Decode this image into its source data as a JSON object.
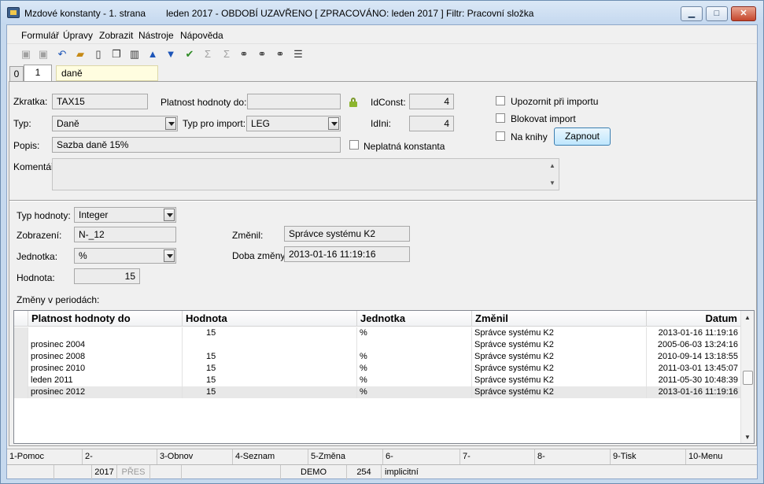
{
  "window": {
    "title": "Mzdové konstanty - 1. strana",
    "status": "leden 2017 - OBDOBÍ UZAVŘENO [ ZPRACOVÁNO: leden 2017 ] Filtr: Pracovní složka",
    "minimize": "▁",
    "maximize": "□",
    "close": "✕"
  },
  "menu": [
    "Formulář",
    "Úpravy",
    "Zobrazit",
    "Nástroje",
    "Nápověda"
  ],
  "tabs": {
    "tab0": "0",
    "tab1": "1",
    "title": "daně"
  },
  "form": {
    "zkratka_label": "Zkratka:",
    "zkratka": "TAX15",
    "platnost_label": "Platnost hodnoty do:",
    "platnost": "",
    "idconst_label": "IdConst:",
    "idconst": "4",
    "idini_label": "IdIni:",
    "idini": "4",
    "typ_label": "Typ:",
    "typ": "Daně",
    "typ_import_label": "Typ pro import:",
    "typ_import": "LEG",
    "popis_label": "Popis:",
    "popis": "Sazba daně 15%",
    "neplatna_label": "Neplatná konstanta",
    "komentar_label": "Komentář:",
    "komentar": "",
    "upozornit_label": "Upozornit při importu",
    "blokovat_label": "Blokovat import",
    "na_knihy_label": "Na knihy",
    "zapnout_label": "Zapnout",
    "typ_hodnoty_label": "Typ hodnoty:",
    "typ_hodnoty": "Integer",
    "zobrazeni_label": "Zobrazení:",
    "zobrazeni": "N-_12",
    "jednotka_label": "Jednotka:",
    "jednotka": "%",
    "hodnota_label": "Hodnota:",
    "hodnota": "15",
    "zmenil_label": "Změnil:",
    "zmenil": "Správce systému K2",
    "doba_label": "Doba změny:",
    "doba": "2013-01-16 11:19:16",
    "zmeny_label": "Změny v periodách:"
  },
  "grid": {
    "headers": [
      "Platnost hodnoty do",
      "Hodnota",
      "Jednotka",
      "Změnil",
      "Datum"
    ],
    "rows": [
      [
        "",
        "15",
        "%",
        "Správce systému K2",
        "2013-01-16 11:19:16"
      ],
      [
        "prosinec 2004",
        "",
        "",
        "Správce systému K2",
        "2005-06-03 13:24:16"
      ],
      [
        "prosinec 2008",
        "15",
        "%",
        "Správce systému K2",
        "2010-09-14 13:18:55"
      ],
      [
        "prosinec 2010",
        "15",
        "%",
        "Správce systému K2",
        "2011-03-01 13:45:07"
      ],
      [
        "leden 2011",
        "15",
        "%",
        "Správce systému K2",
        "2011-05-30 10:48:39"
      ],
      [
        "prosinec 2012",
        "15",
        "%",
        "Správce systému K2",
        "2013-01-16 11:19:16"
      ]
    ]
  },
  "fkeys": [
    "1-Pomoc",
    "2-",
    "3-Obnov",
    "4-Seznam",
    "5-Změna",
    "6-",
    "7-",
    "8-",
    "9-Tisk",
    "10-Menu"
  ],
  "statusbar": {
    "year": "2017",
    "pres": "PŘES",
    "db": "DEMO",
    "num": "254",
    "mode": "implicitní"
  }
}
